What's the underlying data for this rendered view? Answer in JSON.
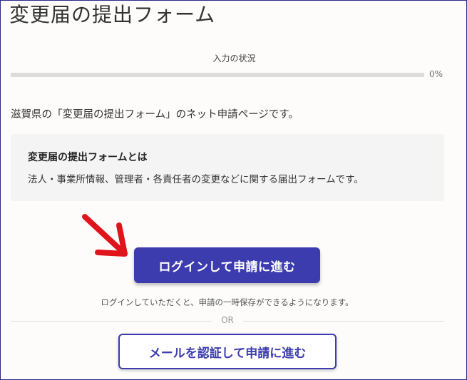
{
  "header": {
    "title": "変更届の提出フォーム"
  },
  "progress": {
    "label": "入力の状況",
    "percent_text": "0%",
    "value": 0
  },
  "intro": {
    "text": "滋賀県の「変更届の提出フォーム」のネット申請ページです。"
  },
  "info_box": {
    "title": "変更届の提出フォームとは",
    "description": "法人・事業所情報、管理者・各責任者の変更などに関する届出フォームです。"
  },
  "login": {
    "button_label": "ログインして申請に進む",
    "note": "ログインしていただくと、申請の一時保存ができるようになります。"
  },
  "divider": {
    "label": "OR"
  },
  "email": {
    "button_label": "メールを認証して申請に進む"
  },
  "colors": {
    "primary": "#3c3caf",
    "annotation_arrow": "#e0141b",
    "frame": "#27288a"
  }
}
